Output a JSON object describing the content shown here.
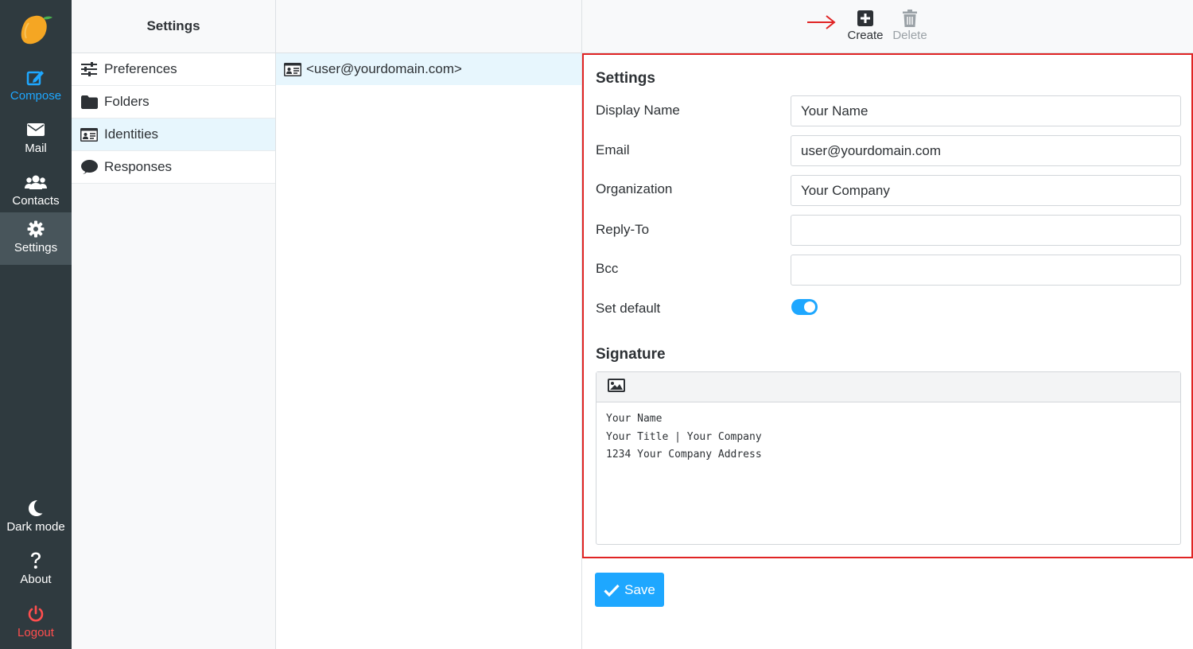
{
  "nav": {
    "items": [
      {
        "label": "Compose",
        "icon": "compose-icon"
      },
      {
        "label": "Mail",
        "icon": "envelope-icon"
      },
      {
        "label": "Contacts",
        "icon": "users-icon"
      },
      {
        "label": "Settings",
        "icon": "gear-icon"
      }
    ],
    "bottom": [
      {
        "label": "Dark mode",
        "icon": "moon-icon"
      },
      {
        "label": "About",
        "icon": "question-icon"
      },
      {
        "label": "Logout",
        "icon": "power-icon"
      }
    ]
  },
  "settings_column": {
    "title": "Settings",
    "items": [
      {
        "label": "Preferences",
        "icon": "sliders-icon"
      },
      {
        "label": "Folders",
        "icon": "folder-icon"
      },
      {
        "label": "Identities",
        "icon": "id-card-icon"
      },
      {
        "label": "Responses",
        "icon": "speech-bubble-icon"
      }
    ]
  },
  "identity_list": {
    "items": [
      "<user@yourdomain.com>"
    ]
  },
  "toolbar": {
    "create_label": "Create",
    "delete_label": "Delete"
  },
  "form": {
    "settings_title": "Settings",
    "fields": [
      {
        "label": "Display Name",
        "value": "Your Name"
      },
      {
        "label": "Email",
        "value": "user@yourdomain.com"
      },
      {
        "label": "Organization",
        "value": "Your Company"
      },
      {
        "label": "Reply-To",
        "value": ""
      },
      {
        "label": "Bcc",
        "value": ""
      }
    ],
    "set_default_label": "Set default",
    "set_default_on": true,
    "signature_title": "Signature",
    "signature_lines": [
      "Your Name",
      "Your Title | Your Company",
      "1234 Your Company Address"
    ],
    "save_label": "Save"
  },
  "colors": {
    "accent": "#1ea7ff",
    "nav_bg": "#2f3a3f",
    "highlight_border": "#e02424",
    "logout": "#ff4e4e"
  }
}
